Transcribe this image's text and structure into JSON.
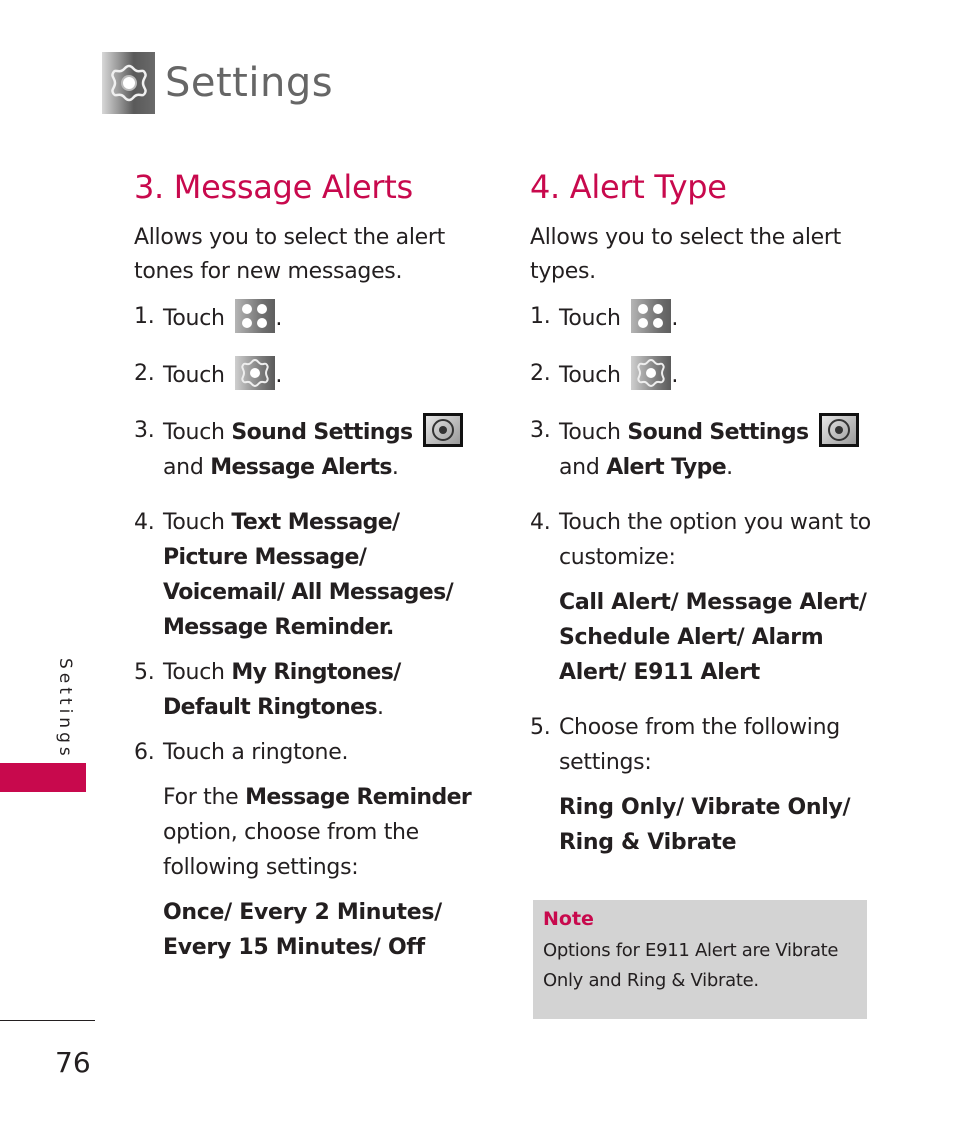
{
  "header": {
    "title": "Settings",
    "icon": "gear-icon"
  },
  "sidebar": {
    "label": "Settings",
    "accent_color": "#c8094d"
  },
  "footer": {
    "page_number": "76"
  },
  "colors": {
    "accent": "#c8094d",
    "title_gray": "#666666",
    "note_bg": "#d3d3d3",
    "text": "#231f20"
  },
  "left": {
    "title": "3. Message Alerts",
    "intro": "Allows you to select the alert tones for new messages.",
    "steps": [
      {
        "num": "1.",
        "pre": "Touch",
        "icon": "menu-grid-icon",
        "post": "."
      },
      {
        "num": "2.",
        "pre": "Touch",
        "icon": "settings-gear-icon",
        "post": "."
      },
      {
        "num": "3.",
        "pre": "Touch ",
        "bold1": "Sound Settings",
        "icon": "sound-settings-icon",
        "mid": "and ",
        "bold2": "Message Alerts",
        "post": "."
      },
      {
        "num": "4.",
        "pre": "Touch ",
        "bold": "Text Message/ Picture Message/ Voicemail/ All Messages/ Message Reminder."
      },
      {
        "num": "5.",
        "pre": "Touch ",
        "bold": "My Ringtones/ Default Ringtones",
        "post": "."
      },
      {
        "num": "6.",
        "text": "Touch a ringtone."
      }
    ],
    "reminder_pre": "For the ",
    "reminder_bold": "Message Reminder",
    "reminder_post": " option, choose from the following settings:",
    "reminder_options": "Once/ Every 2 Minutes/ Every 15 Minutes/ Off"
  },
  "right": {
    "title": "4. Alert Type",
    "intro": "Allows you to select the alert types.",
    "steps": [
      {
        "num": "1.",
        "pre": "Touch",
        "icon": "menu-grid-icon",
        "post": "."
      },
      {
        "num": "2.",
        "pre": "Touch",
        "icon": "settings-gear-icon",
        "post": "."
      },
      {
        "num": "3.",
        "pre": "Touch ",
        "bold1": "Sound Settings",
        "icon": "sound-settings-icon",
        "mid": "and ",
        "bold2": "Alert Type",
        "post": "."
      },
      {
        "num": "4.",
        "text": "Touch the option you want to customize:"
      },
      {
        "num": "5.",
        "text": "Choose from the following settings:"
      }
    ],
    "alert_options": "Call Alert/ Message Alert/ Schedule Alert/ Alarm Alert/ E911 Alert",
    "setting_options": "Ring Only/ Vibrate Only/ Ring & Vibrate"
  },
  "note": {
    "title": "Note",
    "text": "Options for E911 Alert are Vibrate Only and Ring & Vibrate."
  }
}
